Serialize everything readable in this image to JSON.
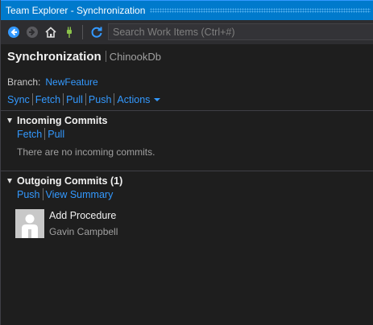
{
  "window": {
    "title": "Team Explorer - Synchronization"
  },
  "toolbar": {
    "search_placeholder": "Search Work Items (Ctrl+#)",
    "icons": [
      "back-icon",
      "forward-icon",
      "home-icon",
      "connect-icon",
      "refresh-icon"
    ]
  },
  "page": {
    "title": "Synchronization",
    "context": "ChinookDb"
  },
  "branch": {
    "label": "Branch:",
    "name": "NewFeature"
  },
  "actions": {
    "sync": "Sync",
    "fetch": "Fetch",
    "pull": "Pull",
    "push": "Push",
    "more": "Actions"
  },
  "incoming": {
    "header": "Incoming Commits",
    "fetch": "Fetch",
    "pull": "Pull",
    "empty_message": "There are no incoming commits."
  },
  "outgoing": {
    "header": "Outgoing Commits (1)",
    "push": "Push",
    "view_summary": "View Summary",
    "commits": [
      {
        "title": "Add Procedure",
        "author": "Gavin Campbell"
      }
    ]
  },
  "colors": {
    "title_bar": "#007acc",
    "background": "#1e1e1e",
    "toolbar": "#2d2d30",
    "link": "#3399ff",
    "text": "#f1f1f1",
    "muted_text": "#a0a0a0",
    "connect_icon": "#8bc34a"
  }
}
